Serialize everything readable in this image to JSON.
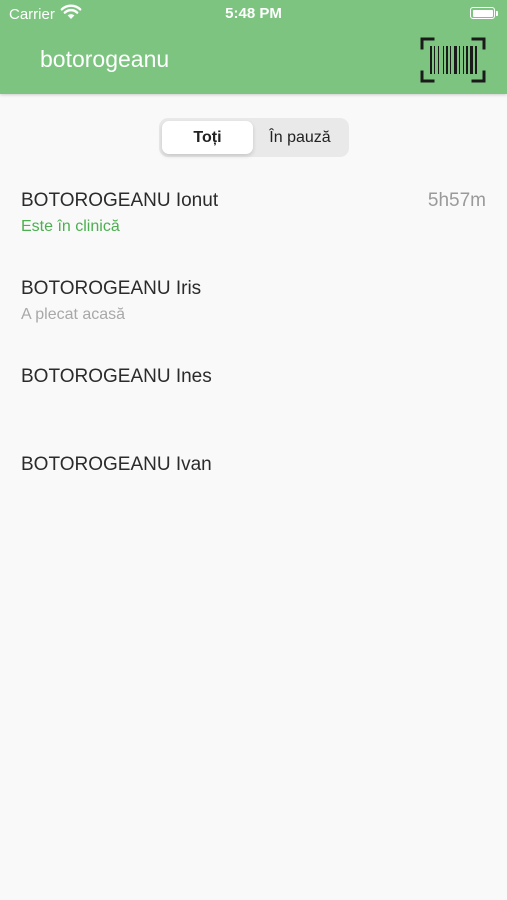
{
  "status_bar": {
    "carrier": "Carrier",
    "time": "5:48 PM"
  },
  "nav": {
    "title": "botorogeanu",
    "scan_icon": "barcode-scanner-icon"
  },
  "segments": [
    {
      "label": "Toți",
      "selected": true
    },
    {
      "label": "În pauză",
      "selected": false
    }
  ],
  "people": [
    {
      "name": "BOTOROGEANU Ionut",
      "status": "Este în clinică",
      "status_color": "#4caf50",
      "duration": "5h57m"
    },
    {
      "name": "BOTOROGEANU Iris",
      "status": "A plecat acasă",
      "status_color": "#a8a8a8",
      "duration": ""
    },
    {
      "name": "BOTOROGEANU Ines",
      "status": "",
      "status_color": "",
      "duration": ""
    },
    {
      "name": "BOTOROGEANU Ivan",
      "status": "",
      "status_color": "",
      "duration": ""
    }
  ],
  "colors": {
    "header": "#7dc481",
    "background": "#f9f9f9",
    "accent_green": "#4caf50"
  }
}
